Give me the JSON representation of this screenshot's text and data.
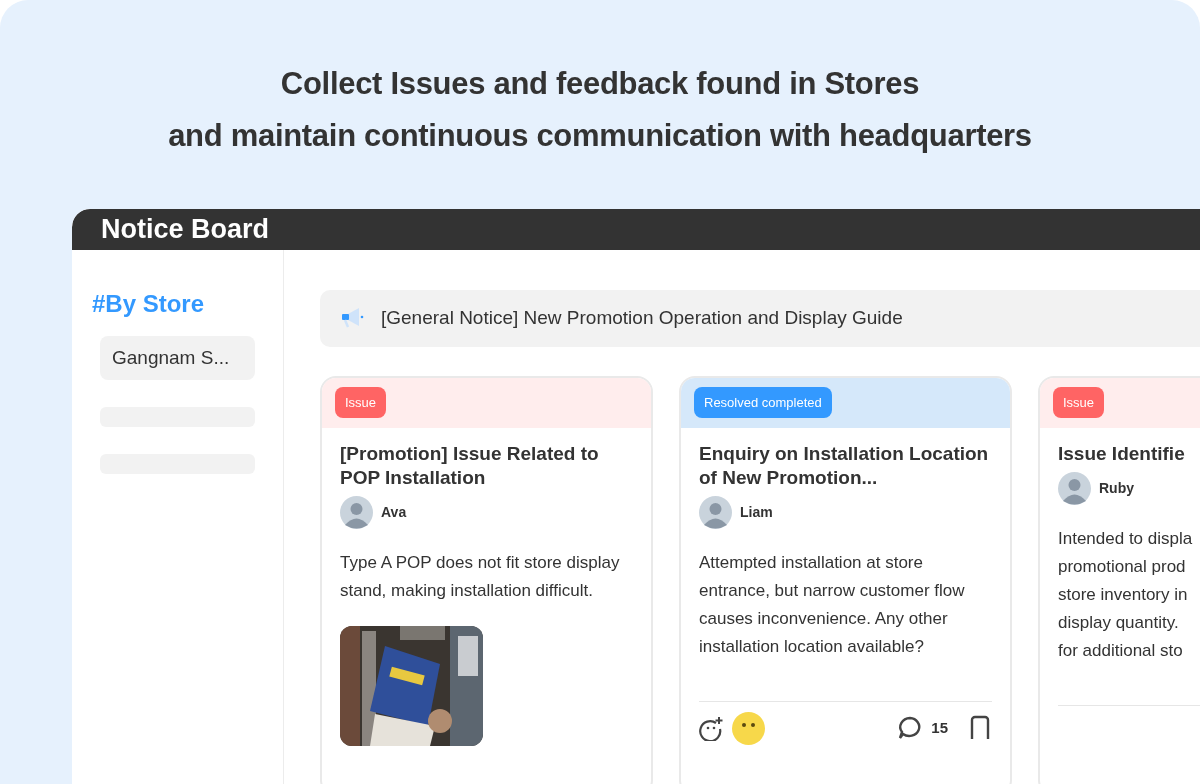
{
  "heading": {
    "lines": [
      "Collect Issues and feedback found in Stores",
      "and maintain continuous communication with headquarters"
    ]
  },
  "window": {
    "title": "Notice Board"
  },
  "sidebar": {
    "title": "#By Store",
    "items": [
      {
        "label": "Gangnam S...",
        "selected": true
      }
    ]
  },
  "notice": {
    "text": "[General Notice] New Promotion Operation and Display Guide"
  },
  "posts": [
    {
      "status": {
        "kind": "issue",
        "label": "Issue"
      },
      "title": "[Promotion] Issue Related to POP Installation",
      "author": "Ava",
      "body": "Type A POP does not fit store display stand, making installation difficult."
    },
    {
      "status": {
        "kind": "resolved",
        "label": "Resolved completed"
      },
      "title": "Enquiry on Installation Location of New Promotion...",
      "author": "Liam",
      "body": "Attempted installation at store entrance, but narrow customer flow causes inconvenience. Any other installation location available?",
      "footer": {
        "comment_count": "15"
      }
    },
    {
      "status": {
        "kind": "issue",
        "label": "Issue"
      },
      "title": "Issue Identifie",
      "author": "Ruby",
      "body_lines": [
        "Intended to displa",
        "promotional prod",
        "store inventory in",
        "display quantity.",
        "for additional sto"
      ]
    }
  ]
}
